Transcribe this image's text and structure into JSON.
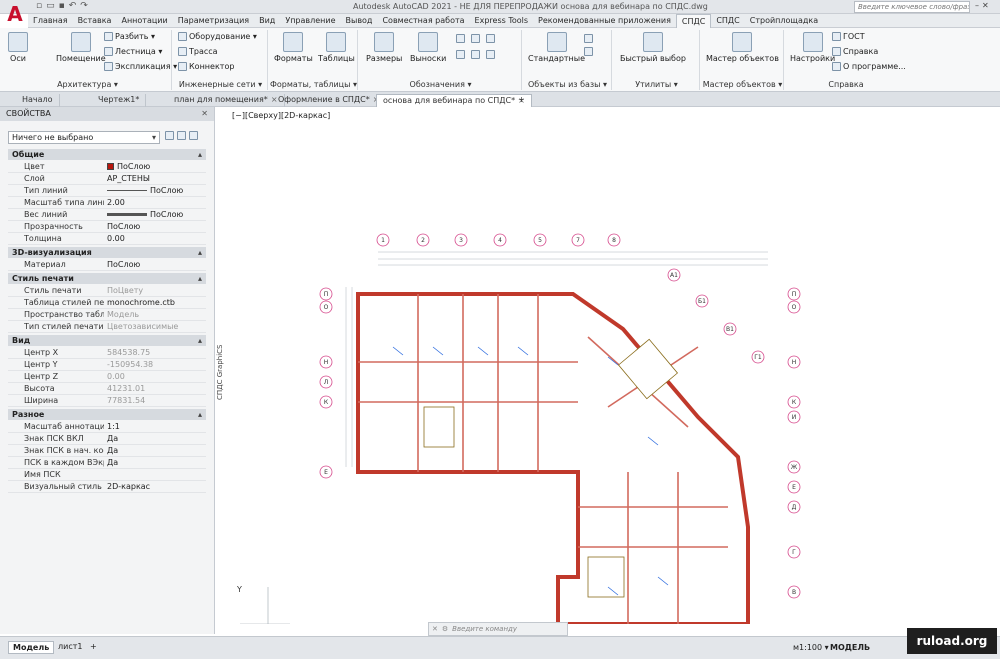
{
  "app": {
    "logo": "A",
    "title": "Autodesk AutoCAD 2021 - НЕ ДЛЯ ПЕРЕПРОДАЖИ   основа для вебинара по СПДС.dwg",
    "search_placeholder": "Введите ключевое слово/фразу"
  },
  "ribbon_tabs": [
    "Главная",
    "Вставка",
    "Аннотации",
    "Параметризация",
    "Вид",
    "Управление",
    "Вывод",
    "Совместная работа",
    "Express Tools",
    "Рекомендованные приложения",
    "СПДС",
    "СПДС",
    "Стройплощадка"
  ],
  "ribbon": {
    "architecture": {
      "title": "Архитектура ▾",
      "axes": "Оси",
      "room": "Помещение",
      "split": "Разбить ▾",
      "stair": "Лестница ▾",
      "explication": "Экспликация ▾"
    },
    "engineering": {
      "title": "Инженерные сети ▾",
      "equipment": "Оборудование ▾",
      "route": "Трасса",
      "connector": "Коннектор"
    },
    "formats": {
      "title": "Форматы, таблицы ▾",
      "formats": "Форматы",
      "tables": "Таблицы"
    },
    "dims": {
      "sizes": "Размеры",
      "leaders": "Выноски"
    },
    "designations": {
      "title": "Обозначения ▾"
    },
    "objects": {
      "title": "Объекты из базы ▾",
      "standard": "Стандартные"
    },
    "utilities": {
      "title": "Утилиты ▾",
      "quick_select": "Быстрый выбор"
    },
    "master": {
      "title": "Мастер объектов ▾",
      "master": "Мастер объектов"
    },
    "help": {
      "title": "Справка",
      "settings": "Настройки",
      "gost": "ГОСТ",
      "help": "Справка",
      "about": "О программе..."
    }
  },
  "doc_tabs": [
    "Начало",
    "Чертеж1*",
    "план для помещения*",
    "Оформление в СПДС*",
    "основа для вебинара по СПДС*"
  ],
  "properties": {
    "header": "СВОЙСТВА",
    "selection": "Ничего не выбрано",
    "sections": [
      {
        "title": "Общие",
        "rows": [
          {
            "label": "Цвет",
            "value": "ПоСлою"
          },
          {
            "label": "Слой",
            "value": "АР_СТЕНЫ"
          },
          {
            "label": "Тип линий",
            "value": "ПоСлою"
          },
          {
            "label": "Масштаб типа линий",
            "value": "2.00"
          },
          {
            "label": "Вес линий",
            "value": "ПоСлою"
          },
          {
            "label": "Прозрачность",
            "value": "ПоСлою"
          },
          {
            "label": "Толщина",
            "value": "0.00"
          }
        ]
      },
      {
        "title": "3D-визуализация",
        "rows": [
          {
            "label": "Материал",
            "value": "ПоСлою"
          }
        ]
      },
      {
        "title": "Стиль печати",
        "rows": [
          {
            "label": "Стиль печати",
            "value": "ПоЦвету"
          },
          {
            "label": "Таблица стилей печ...",
            "value": "monochrome.ctb"
          },
          {
            "label": "Пространство табли...",
            "value": "Модель"
          },
          {
            "label": "Тип стилей печати",
            "value": "Цветозависимые"
          }
        ]
      },
      {
        "title": "Вид",
        "rows": [
          {
            "label": "Центр X",
            "value": "584538.75"
          },
          {
            "label": "Центр Y",
            "value": "-150954.38"
          },
          {
            "label": "Центр Z",
            "value": "0.00"
          },
          {
            "label": "Высота",
            "value": "41231.01"
          },
          {
            "label": "Ширина",
            "value": "77831.54"
          }
        ]
      },
      {
        "title": "Разное",
        "rows": [
          {
            "label": "Масштаб аннотаций",
            "value": "1:1"
          },
          {
            "label": "Знак ПСК ВКЛ",
            "value": "Да"
          },
          {
            "label": "Знак ПСК в нач. коо...",
            "value": "Да"
          },
          {
            "label": "ПСК в каждом ВЭкр...",
            "value": "Да"
          },
          {
            "label": "Имя ПСК",
            "value": ""
          },
          {
            "label": "Визуальный стиль",
            "value": "2D-каркас"
          }
        ]
      }
    ],
    "vertical_label": "СПДС GraphiCS"
  },
  "viewport": {
    "label": "[−][Сверху][2D-каркас]",
    "axis_y": "Y"
  },
  "plan": {
    "col_axes": [
      "1",
      "2",
      "3",
      "4",
      "5",
      "7",
      "8"
    ],
    "row_axes_left": [
      "П",
      "О",
      "Н",
      "Л",
      "К",
      "Е"
    ],
    "row_axes_right": [
      "П",
      "О",
      "Н",
      "К",
      "И",
      "Ж",
      "Е",
      "Д",
      "Г",
      "В"
    ],
    "diag_axes": [
      "А1",
      "Б1",
      "В1",
      "Г1"
    ]
  },
  "command": {
    "placeholder": "Введите команду"
  },
  "status": {
    "model_tab": "Модель",
    "layout_tab": "лист1",
    "add": "+",
    "scale": "м1:100 ▾",
    "mode": "МОДЕЛЬ"
  },
  "watermark": "ruload.org"
}
